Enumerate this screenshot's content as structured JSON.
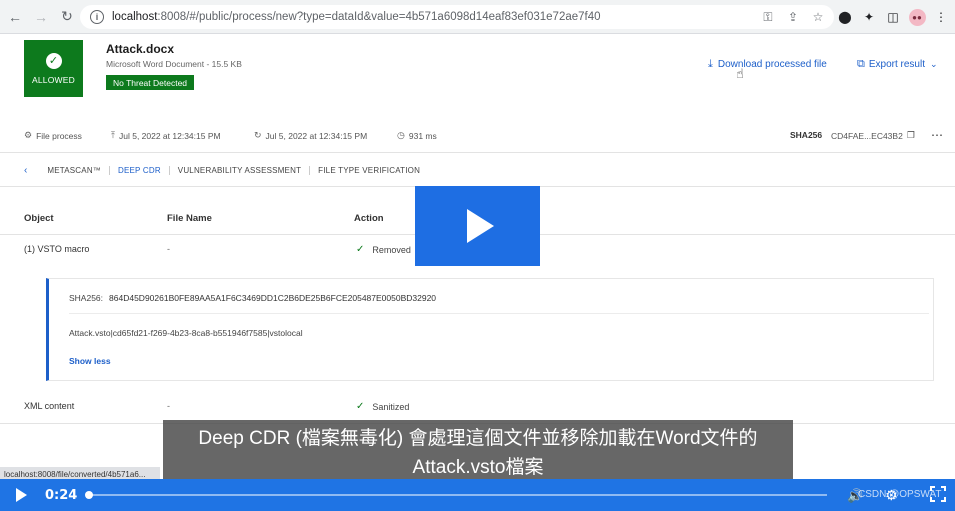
{
  "browser": {
    "url_host": "localhost",
    "url_path": ":8008/#/public/process/new?type=dataId&value=4b571a6098d14eaf83ef031e72ae7f40",
    "status_url": "localhost:8008/file/converted/4b571a6..."
  },
  "result": {
    "verdict": "ALLOWED",
    "file_name": "Attack.docx",
    "file_meta": "Microsoft Word Document - 15.5 KB",
    "threat_status": "No Threat Detected",
    "download_label": "Download processed file",
    "export_label": "Export result"
  },
  "meta": {
    "process_type": "File process",
    "start_time": "Jul 5, 2022 at 12:34:15 PM",
    "end_time": "Jul 5, 2022 at 12:34:15 PM",
    "duration": "931 ms",
    "sha_label": "SHA256",
    "sha_value": "CD4FAE...EC43B2"
  },
  "tabs": [
    {
      "label": "METASCAN™"
    },
    {
      "label": "DEEP CDR"
    },
    {
      "label": "VULNERABILITY ASSESSMENT"
    },
    {
      "label": "FILE TYPE VERIFICATION"
    }
  ],
  "table": {
    "headers": {
      "object": "Object",
      "file_name": "File Name",
      "action": "Action"
    },
    "rows": [
      {
        "object": "(1) VSTO macro",
        "file_name": "-",
        "action": "Removed"
      },
      {
        "object": "XML content",
        "file_name": "-",
        "action": "Sanitized"
      }
    ],
    "detail": {
      "sha_label": "SHA256:",
      "sha_value": "864D45D90261B0FE89AA5A1F6C3469DD1C2B6DE25B6FCE205487E0050BD32920",
      "path": "Attack.vsto|cd65fd21-f269-4b23-8ca8-b551946f7585|vstolocal",
      "toggle_label": "Show less"
    }
  },
  "video": {
    "subtitle_line1": "Deep CDR (檔案無毒化) 會處理這個文件並移除加載在Word文件的",
    "subtitle_line2": "Attack.vsto檔案",
    "current_time": "0:24",
    "progress_percent": 0.3,
    "watermark": "CSDN @OPSWAT"
  },
  "colors": {
    "allowed_green": "#0d7a1d",
    "link_blue": "#1d5fc9",
    "player_blue": "#1f74e4"
  }
}
